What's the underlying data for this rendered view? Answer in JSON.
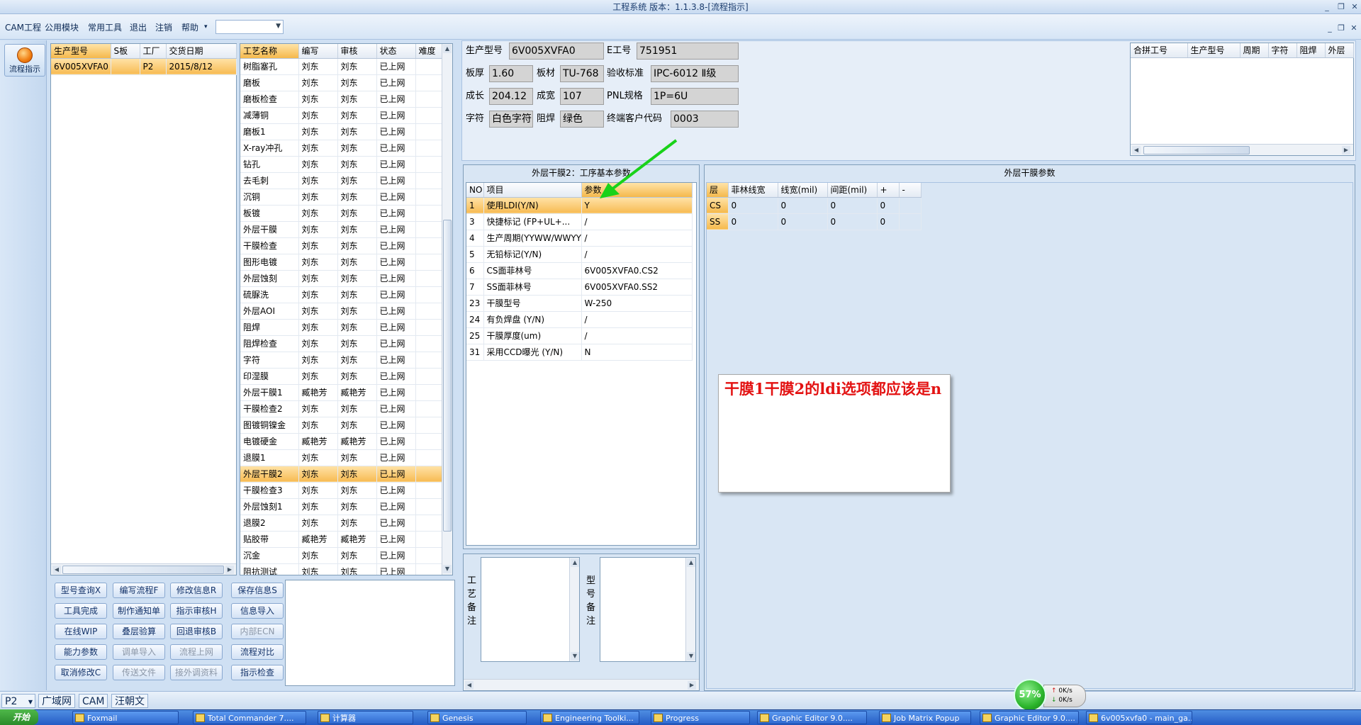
{
  "window": {
    "title": "工程系统 版本：1.1.3.8-[流程指示]",
    "min": "_",
    "restore": "❐",
    "close": "✕",
    "inner_close": "✕",
    "inner_min": "_",
    "inner_restore": "❐"
  },
  "menu": {
    "items": [
      "CAM工程",
      "公用模块",
      "常用工具",
      "退出",
      "注销",
      "帮助"
    ],
    "help_arrow": "▾",
    "combo_value": ""
  },
  "sidebar": {
    "flow_button": "流程指示"
  },
  "order_list": {
    "columns": [
      "生产型号",
      "S板",
      "工厂",
      "交货日期"
    ],
    "rows": [
      [
        "6V005XVFA0",
        "",
        "P2",
        "2015/8/12"
      ]
    ]
  },
  "process_list": {
    "columns": [
      "工艺名称",
      "编写",
      "审核",
      "状态",
      "难度"
    ],
    "rows": [
      [
        "树脂塞孔",
        "刘东",
        "刘东",
        "已上网",
        ""
      ],
      [
        "磨板",
        "刘东",
        "刘东",
        "已上网",
        ""
      ],
      [
        "磨板检查",
        "刘东",
        "刘东",
        "已上网",
        ""
      ],
      [
        "减薄铜",
        "刘东",
        "刘东",
        "已上网",
        ""
      ],
      [
        "磨板1",
        "刘东",
        "刘东",
        "已上网",
        ""
      ],
      [
        "X-ray冲孔",
        "刘东",
        "刘东",
        "已上网",
        ""
      ],
      [
        "钻孔",
        "刘东",
        "刘东",
        "已上网",
        ""
      ],
      [
        "去毛刺",
        "刘东",
        "刘东",
        "已上网",
        ""
      ],
      [
        "沉铜",
        "刘东",
        "刘东",
        "已上网",
        ""
      ],
      [
        "板镀",
        "刘东",
        "刘东",
        "已上网",
        ""
      ],
      [
        "外层干膜",
        "刘东",
        "刘东",
        "已上网",
        ""
      ],
      [
        "干膜检查",
        "刘东",
        "刘东",
        "已上网",
        ""
      ],
      [
        "图形电镀",
        "刘东",
        "刘东",
        "已上网",
        ""
      ],
      [
        "外层蚀刻",
        "刘东",
        "刘东",
        "已上网",
        ""
      ],
      [
        "硫脲洗",
        "刘东",
        "刘东",
        "已上网",
        ""
      ],
      [
        "外层AOI",
        "刘东",
        "刘东",
        "已上网",
        ""
      ],
      [
        "阻焊",
        "刘东",
        "刘东",
        "已上网",
        ""
      ],
      [
        "阻焊检查",
        "刘东",
        "刘东",
        "已上网",
        ""
      ],
      [
        "字符",
        "刘东",
        "刘东",
        "已上网",
        ""
      ],
      [
        "印湿膜",
        "刘东",
        "刘东",
        "已上网",
        ""
      ],
      [
        "外层干膜1",
        "臧艳芳",
        "臧艳芳",
        "已上网",
        ""
      ],
      [
        "干膜检查2",
        "刘东",
        "刘东",
        "已上网",
        ""
      ],
      [
        "图镀铜镍金",
        "刘东",
        "刘东",
        "已上网",
        ""
      ],
      [
        "电镀硬金",
        "臧艳芳",
        "臧艳芳",
        "已上网",
        ""
      ],
      [
        "退膜1",
        "刘东",
        "刘东",
        "已上网",
        ""
      ],
      [
        "外层干膜2",
        "刘东",
        "刘东",
        "已上网",
        ""
      ],
      [
        "干膜检查3",
        "刘东",
        "刘东",
        "已上网",
        ""
      ],
      [
        "外层蚀刻1",
        "刘东",
        "刘东",
        "已上网",
        ""
      ],
      [
        "退膜2",
        "刘东",
        "刘东",
        "已上网",
        ""
      ],
      [
        "贴胶带",
        "臧艳芳",
        "臧艳芳",
        "已上网",
        ""
      ],
      [
        "沉金",
        "刘东",
        "刘东",
        "已上网",
        ""
      ],
      [
        "阻抗测试",
        "刘东",
        "刘东",
        "已上网",
        ""
      ]
    ],
    "selected_index": 25
  },
  "actions": [
    [
      "型号查询X",
      "编写流程F",
      "修改信息R",
      "保存信息S"
    ],
    [
      "工具完成",
      "制作通知单",
      "指示审核H",
      "信息导入"
    ],
    [
      "在线WIP",
      "叠层验算",
      "回退审核B",
      "内部ECN"
    ],
    [
      "能力参数",
      "调单导入",
      "流程上网",
      "流程对比"
    ],
    [
      "取消修改C",
      "传送文件",
      "接外调资料",
      "指示检查"
    ]
  ],
  "actions_disabled": [
    "内部ECN",
    "调单导入",
    "流程上网",
    "传送文件",
    "接外调资料"
  ],
  "info": {
    "prod_model_label": "生产型号",
    "prod_model": "6V005XVFA0",
    "e_no_label": "E工号",
    "e_no": "751951",
    "thick_label": "板厚",
    "thick": "1.60",
    "material_label": "板材",
    "material": "TU-768",
    "std_label": "验收标准",
    "std": "IPC-6012 Ⅱ级",
    "len_label": "成长",
    "len": "204.12",
    "width_label": "成宽",
    "width": "107",
    "pnl_label": "PNL规格",
    "pnl": "1P=6U",
    "char_label": "字符",
    "char": "白色字符",
    "mask_label": "阻焊",
    "mask": "绿色",
    "cust_label": "终端客户代码",
    "cust": "0003"
  },
  "merge_table": {
    "columns": [
      "合拼工号",
      "生产型号",
      "周期",
      "字符",
      "阻焊",
      "外层"
    ]
  },
  "params_section": {
    "caption": "外层干膜2：工序基本参数",
    "columns": [
      "NO",
      "项目",
      "参数"
    ],
    "rows": [
      [
        "1",
        "使用LDI(Y/N)",
        "Y"
      ],
      [
        "3",
        "快捷标记 (FP+UL+...",
        ""
      ],
      [
        "4",
        "生产周期(YYWW/WWYY)",
        "/"
      ],
      [
        "5",
        "无铅标记(Y/N)",
        "/"
      ],
      [
        "6",
        "CS面菲林号",
        "6V005XVFA0.CS2"
      ],
      [
        "7",
        "SS面菲林号",
        "6V005XVFA0.SS2"
      ],
      [
        "23",
        "干膜型号",
        "W-250"
      ],
      [
        "24",
        "有负焊盘 (Y/N)",
        "/"
      ],
      [
        "25",
        "干膜厚度(um)",
        "/"
      ],
      [
        "31",
        "采用CCD曝光 (Y/N)",
        "N"
      ]
    ],
    "row2_value": "/",
    "selected_index": 0
  },
  "outer_section": {
    "caption": "外层干膜参数",
    "columns": [
      "层",
      "菲林线宽",
      "线宽(mil)",
      "间距(mil)",
      "+",
      "-"
    ],
    "rows": [
      [
        "CS",
        "0",
        "0",
        "0",
        "0",
        ""
      ],
      [
        "SS",
        "0",
        "0",
        "0",
        "0",
        ""
      ]
    ]
  },
  "remarks": {
    "process_label": "工艺备注",
    "model_label": "型号备注"
  },
  "note": {
    "text": "干膜1干膜2的ldi选项都应该是n"
  },
  "bottom_tabs": [
    "P2",
    "广域网",
    "CAM",
    "汪朝文"
  ],
  "net": {
    "percent": "57%",
    "up": "0K/s",
    "down": "0K/s"
  },
  "taskbar": {
    "start": "开始",
    "items": [
      "Foxmail",
      "Total Commander 7....",
      "计算器",
      "Genesis",
      "Engineering Toolki...",
      "Progress",
      "Graphic Editor 9.0....",
      "Job Matrix Popup",
      "Graphic Editor 9.0....",
      "6v005xvfa0 - main_ga..."
    ]
  },
  "colors": {
    "accent": "#f5b94c",
    "note_red": "#e31212",
    "arrow_green": "#19d219"
  }
}
